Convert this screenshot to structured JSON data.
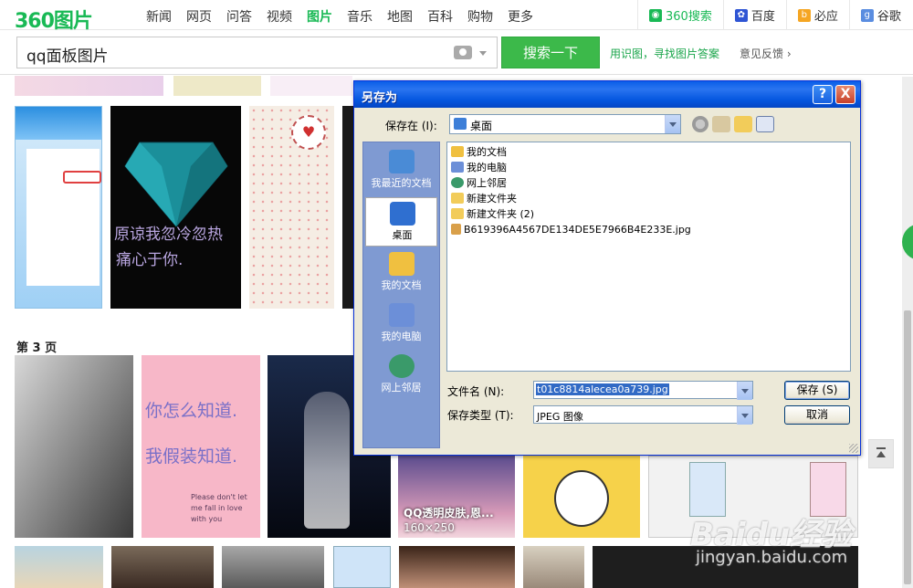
{
  "logo": {
    "text": "360图片"
  },
  "nav": {
    "links": [
      "新闻",
      "网页",
      "问答",
      "视频",
      "图片",
      "音乐",
      "地图",
      "百科",
      "购物",
      "更多"
    ],
    "active_index": 4
  },
  "engines": [
    {
      "label": "360搜索",
      "icon": "360-search-icon",
      "color": "#19b955"
    },
    {
      "label": "百度",
      "icon": "baidu-paw-icon",
      "color": "#2f55d4"
    },
    {
      "label": "必应",
      "icon": "bing-icon",
      "color": "#f5a623"
    },
    {
      "label": "谷歌",
      "icon": "google-icon",
      "color": "#5a8de0"
    }
  ],
  "search": {
    "value": "qq面板图片",
    "button_label": "搜索一下",
    "shitu_text": "用识图，寻找图片答案",
    "feedback_text": "意见反馈"
  },
  "gallery": {
    "thumb_text_1": "原谅我忽冷忽热",
    "thumb_text_1b": "痛心于你.",
    "page3_label": "第 3 页",
    "pink_line1": "你怎么知道.",
    "pink_line2": "我假装知道.",
    "pink_small": "Please don't let me fall in love with you",
    "caption_title": "QQ透明皮肤,恩...",
    "caption_size": "160×250"
  },
  "watermark": {
    "line1": "Baidu经验",
    "line2": "jingyan.baidu.com"
  },
  "dialog": {
    "title": "另存为",
    "help_label": "?",
    "close_label": "X",
    "save_in_label": "保存在 (I):",
    "save_in_value": "桌面",
    "places": [
      {
        "label": "我最近的文档",
        "icon": "recent-docs-icon",
        "color": "#4a8bd6"
      },
      {
        "label": "桌面",
        "icon": "desktop-icon",
        "color": "#2f6fd0"
      },
      {
        "label": "我的文档",
        "icon": "my-documents-icon",
        "color": "#f0c040"
      },
      {
        "label": "我的电脑",
        "icon": "my-computer-icon",
        "color": "#6c8fd8"
      },
      {
        "label": "网上邻居",
        "icon": "network-places-icon",
        "color": "#3a9a6a"
      }
    ],
    "files": [
      {
        "name": "我的文档",
        "icon": "my-documents-icon",
        "color": "#f0c040"
      },
      {
        "name": "我的电脑",
        "icon": "my-computer-icon",
        "color": "#6c8fd8"
      },
      {
        "name": "网上邻居",
        "icon": "network-places-icon",
        "color": "#3a9a6a"
      },
      {
        "name": "新建文件夹",
        "icon": "folder-icon",
        "color": "#f2cc5a"
      },
      {
        "name": "新建文件夹 (2)",
        "icon": "folder-icon",
        "color": "#f2cc5a"
      },
      {
        "name": "B619396A4567DE134DE5E7966B4E233E.jpg",
        "icon": "jpg-file-icon",
        "color": "#d9a04a"
      }
    ],
    "filename_label": "文件名 (N):",
    "filename_value": "t01c8814alecea0a739.jpg",
    "filetype_label": "保存类型 (T):",
    "filetype_value": "JPEG 图像",
    "save_button": "保存 (S)",
    "cancel_button": "取消"
  }
}
